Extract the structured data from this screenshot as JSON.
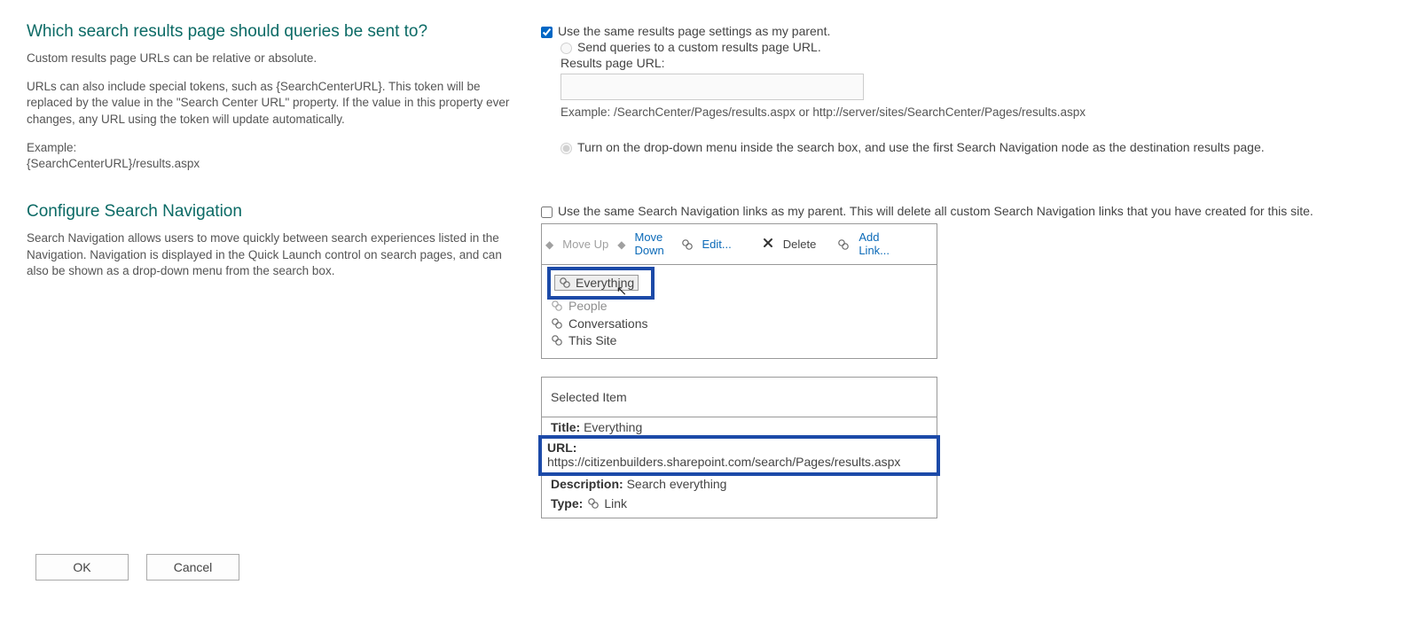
{
  "section1": {
    "title": "Which search results page should queries be sent to?",
    "help1": "Custom results page URLs can be relative or absolute.",
    "help2": "URLs can also include special tokens, such as {SearchCenterURL}. This token will be replaced by the value in the \"Search Center URL\" property. If the value in this property ever changes, any URL using the token will update automatically.",
    "help3": "Example:",
    "help4": "{SearchCenterURL}/results.aspx",
    "checkbox_label": "Use the same results page settings as my parent.",
    "radio1_label": "Send queries to a custom results page URL.",
    "results_url_label": "Results page URL:",
    "example_label": "Example: /SearchCenter/Pages/results.aspx or http://server/sites/SearchCenter/Pages/results.aspx",
    "radio2_label": "Turn on the drop-down menu inside the search box, and use the first Search Navigation node as the destination results page."
  },
  "section2": {
    "title": "Configure Search Navigation",
    "help1": "Search Navigation allows users to move quickly between search experiences listed in the Navigation. Navigation is displayed in the Quick Launch control on search pages, and can also be shown as a drop-down menu from the search box.",
    "parent_checkbox": "Use the same Search Navigation links as my parent. This will delete all custom Search Navigation links that you have created for this site.",
    "toolbar": {
      "moveup": "Move Up",
      "movedown": "Move Down",
      "edit": "Edit...",
      "delete": "Delete",
      "addlink": "Add Link..."
    },
    "items": [
      {
        "label": "Everything"
      },
      {
        "label": "People"
      },
      {
        "label": "Conversations"
      },
      {
        "label": "This Site"
      }
    ],
    "details": {
      "header": "Selected Item",
      "title_label": "Title:",
      "title_value": "Everything",
      "url_label": "URL:",
      "url_value": "https://citizenbuilders.sharepoint.com/search/Pages/results.aspx",
      "desc_label": "Description:",
      "desc_value": "Search everything",
      "type_label": "Type:",
      "type_value": "Link"
    }
  },
  "buttons": {
    "ok": "OK",
    "cancel": "Cancel"
  }
}
